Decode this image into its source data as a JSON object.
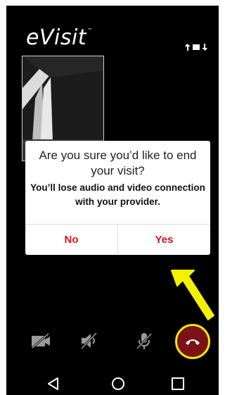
{
  "app": {
    "logo_text": "eVisit",
    "logo_mark": "™"
  },
  "icons": {
    "switch_camera": "switch-camera-icon",
    "video_off": "video-off-icon",
    "speaker_off": "speaker-off-icon",
    "mic_off": "mic-off-icon",
    "end_call": "end-call-icon",
    "nav_back": "nav-back-icon",
    "nav_home": "nav-home-icon",
    "nav_recent": "nav-recent-icon"
  },
  "dialog": {
    "title": "Are you sure you’d like to end your visit?",
    "body": "You’ll lose audio and video connection with your provider.",
    "no_label": "No",
    "yes_label": "Yes"
  },
  "colors": {
    "background": "#000000",
    "accent_red": "#d01822",
    "end_call_fill": "#7a1216",
    "highlight_yellow": "#f0e800"
  }
}
